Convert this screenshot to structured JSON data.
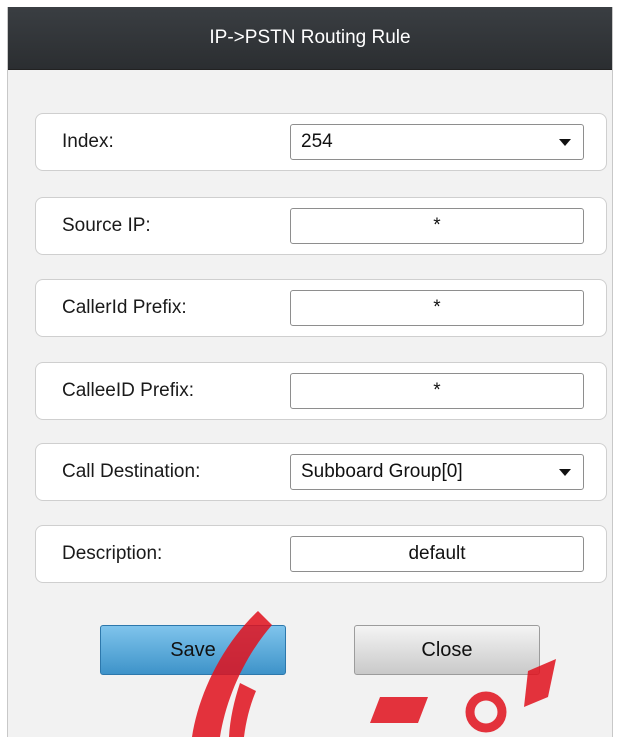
{
  "dialog": {
    "title": "IP->PSTN Routing Rule"
  },
  "form": {
    "index": {
      "label": "Index:",
      "value": "254"
    },
    "source_ip": {
      "label": "Source IP:",
      "value": "*"
    },
    "callerid_prefix": {
      "label": "CallerId Prefix:",
      "value": "*"
    },
    "calleeid_prefix": {
      "label": "CalleeID Prefix:",
      "value": "*"
    },
    "call_destination": {
      "label": "Call Destination:",
      "value": "Subboard Group[0]"
    },
    "description": {
      "label": "Description:",
      "value": "default"
    }
  },
  "buttons": {
    "save": "Save",
    "close": "Close"
  },
  "colors": {
    "titlebar": "#2f3235",
    "save_button": "#4a9fd4",
    "watermark": "#e0101c"
  },
  "icons": {
    "dropdown": "chevron-down-icon"
  }
}
